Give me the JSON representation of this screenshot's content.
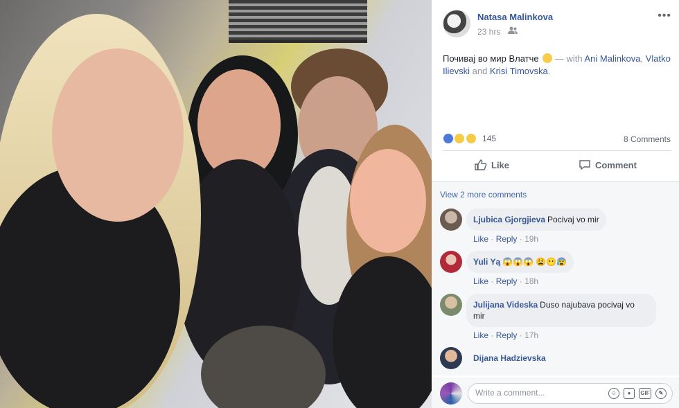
{
  "post": {
    "author": "Natasa Malinkova",
    "time": "23 hrs",
    "audience_icon": "friends-icon",
    "text_main": "Почивај во мир Влатче",
    "with_text": "— with",
    "tags": [
      "Ani Malinkova",
      "Vlatko Ilievski",
      "Krisi Timovska"
    ],
    "sep_comma": ",",
    "sep_and": "and",
    "end_period": ".",
    "reactions": [
      "like",
      "sad",
      "wow"
    ],
    "reaction_count": "145",
    "comments_count": "8 Comments"
  },
  "actions": {
    "like": "Like",
    "comment": "Comment"
  },
  "comments": {
    "view_more": "View 2 more comments",
    "items": [
      {
        "name": "Ljubica Gjorgjieva",
        "text": "Pocivaj vo mir",
        "like": "Like",
        "reply": "Reply",
        "time": "19h"
      },
      {
        "name": "Yuli Yą",
        "text": "😱😱😱 😩😶😰",
        "like": "Like",
        "reply": "Reply",
        "time": "18h"
      },
      {
        "name": "Julijana Videska",
        "text": "Duso najubava pocivaj vo",
        "text2": "mir",
        "like": "Like",
        "reply": "Reply",
        "time": "17h"
      },
      {
        "name": "Dijana Hadzievska",
        "text": ""
      }
    ],
    "dot": "·"
  },
  "composer": {
    "placeholder": "Write a comment...",
    "gif": "GIF"
  },
  "colors": {
    "link": "#365899",
    "meta": "#90949c",
    "bubble": "#eceef1"
  }
}
